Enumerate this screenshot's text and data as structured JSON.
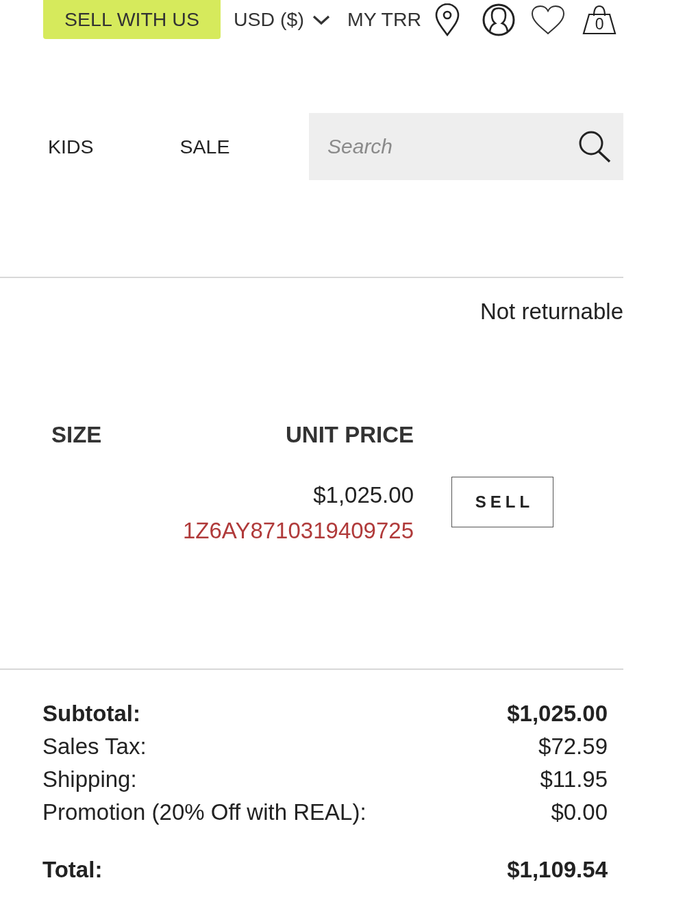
{
  "header": {
    "sell_button": "SELL WITH US",
    "currency": "USD ($)",
    "account_link": "MY TRR",
    "cart_count": "0"
  },
  "nav": {
    "links": [
      "KIDS",
      "SALE"
    ],
    "search": {
      "placeholder": "Search"
    }
  },
  "item": {
    "return_note": "Not returnable",
    "columns": [
      "SIZE",
      "UNIT PRICE"
    ],
    "unit_price": "$1,025.00",
    "tracking_number": "1Z6AY8710319409725",
    "action": "SELL"
  },
  "summary": {
    "rows": [
      {
        "label": "Subtotal:",
        "value": "$1,025.00",
        "kind": "bold"
      },
      {
        "label": "Sales Tax:",
        "value": "$72.59",
        "kind": "plain"
      },
      {
        "label": "Shipping:",
        "value": "$11.95",
        "kind": "plain"
      },
      {
        "label": "Promotion (20% Off with REAL):",
        "value": "$0.00",
        "kind": "plain"
      },
      {
        "label": "Total:",
        "value": "$1,109.54",
        "kind": "total"
      }
    ]
  }
}
